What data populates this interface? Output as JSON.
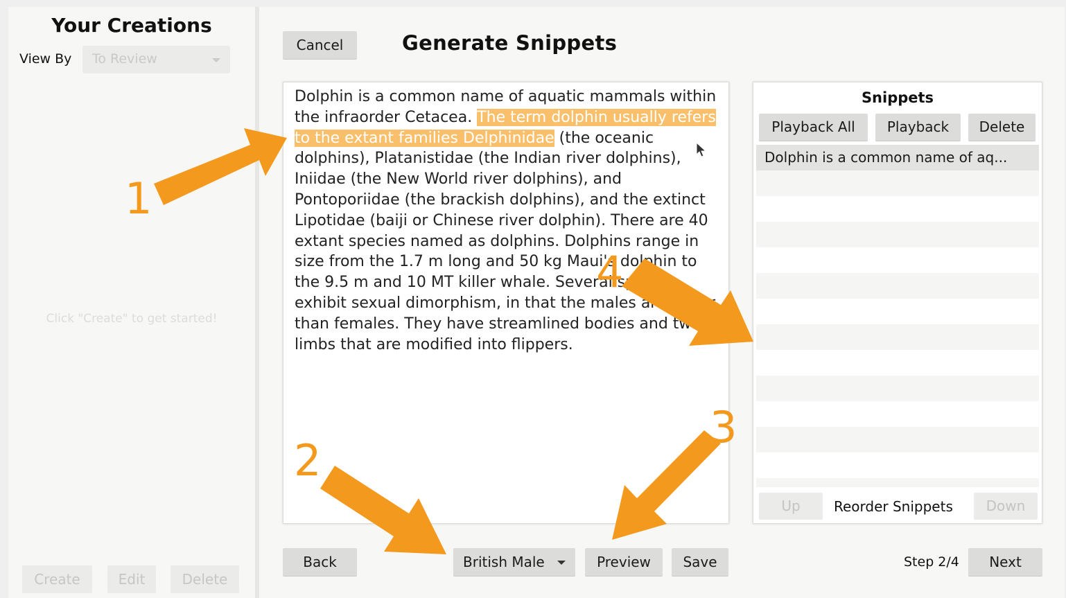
{
  "sidebar": {
    "title": "Your Creations",
    "view_by_label": "View By",
    "view_by_value": "To Review",
    "empty_message": "Click \"Create\" to get started!",
    "buttons": {
      "create": "Create",
      "edit": "Edit",
      "delete": "Delete"
    }
  },
  "header": {
    "cancel_label": "Cancel",
    "title": "Generate Snippets"
  },
  "editor": {
    "text_before": "Dolphin is a common name of aquatic mammals within the infraorder Cetacea. ",
    "text_highlight": "The term dolphin usually refers to the extant families Delphinidae",
    "text_after": " (the oceanic dolphins), Platanistidae (the Indian river dolphins), Iniidae (the New World river dolphins), and Pontoporiidae (the brackish dolphins), and the extinct Lipotidae (baiji or Chinese river dolphin). There are 40 extant species named as dolphins. Dolphins range in size from the 1.7 m long and 50 kg Maui's dolphin to the 9.5 m and 10 MT killer whale. Several species exhibit sexual dimorphism, in that the males are larger than females. They have streamlined bodies and two limbs that are modified into flippers."
  },
  "snippets": {
    "title": "Snippets",
    "playback_all_label": "Playback All",
    "playback_label": "Playback",
    "delete_label": "Delete",
    "items": [
      "Dolphin is a common name of aq..."
    ],
    "up_label": "Up",
    "reorder_label": "Reorder Snippets",
    "down_label": "Down"
  },
  "footer": {
    "back_label": "Back",
    "voice_value": "British Male",
    "preview_label": "Preview",
    "save_label": "Save",
    "step_label": "Step 2/4",
    "next_label": "Next"
  },
  "annotations": {
    "arrow_color": "#f39a1e",
    "numbers": [
      "1",
      "2",
      "3",
      "4"
    ]
  },
  "colors": {
    "highlight": "#f9bf6a"
  }
}
